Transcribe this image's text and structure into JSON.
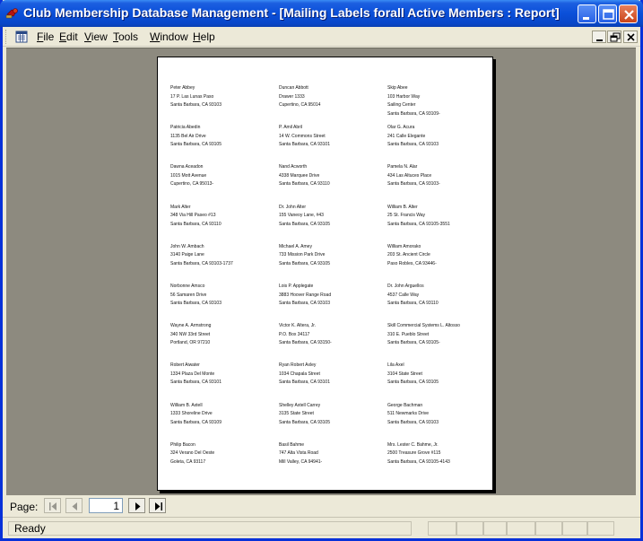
{
  "window": {
    "title": "Club Membership Database Management - [Mailing Labels forall  Active Members : Report]"
  },
  "menu": {
    "items": [
      {
        "key": "F",
        "rest": "ile"
      },
      {
        "key": "E",
        "rest": "dit"
      },
      {
        "key": "V",
        "rest": "iew"
      },
      {
        "key": "T",
        "rest": "ools"
      },
      {
        "key": "W",
        "rest": "indow"
      },
      {
        "key": "H",
        "rest": "elp"
      }
    ]
  },
  "report": {
    "labels": [
      [
        "Peter Abbey",
        "17 P. Las Lunas Paso",
        "Santa Barbara, CA 93103"
      ],
      [
        "Duncan Abbott",
        "Drawer 1333",
        "Cupertino, CA 95014"
      ],
      [
        "Skip Abee",
        "103 Harbor Way",
        "Sailing Center",
        "Santa Barbara, CA 93109-"
      ],
      [
        "Patricia Abedin",
        "1135 Bel Air Drive",
        "Santa Barbara, CA 93105"
      ],
      [
        "P. Amil Abril",
        "14 W. Commons Street",
        "Santa Barbara, CA 93101"
      ],
      [
        "Olar G. Acura",
        "241 Calle Elegante",
        "Santa Barbara, CA 93103"
      ],
      [
        "Dawna Aceadon",
        "1015 Mott Avenue",
        "Cupertino, CA 95013-"
      ],
      [
        "Nand Acworth",
        "4338 Marquee Drive",
        "Santa Barbara, CA 93110"
      ],
      [
        "Pamela N. Alar",
        "434 Las Altuces Place",
        "Santa Barbara, CA 93103-"
      ],
      [
        "Mark Alter",
        "348 Via Hill Paseo #13",
        "Santa Barbara, CA 93110"
      ],
      [
        "Dr. John Alter",
        "155 Vaneoy Lane, #43",
        "Santa Barbara, CA 93105"
      ],
      [
        "William B. Alter",
        "25 St. Francis Way",
        "Santa Barbara, CA 93105-3551"
      ],
      [
        "John W. Ambach",
        "3140 Paige Lane",
        "Santa Barbara, CA 93103-1737"
      ],
      [
        "Michael A. Amey",
        "733 Mission Park Drive",
        "Santa Barbara, CA 93105"
      ],
      [
        "William Amorako",
        "203 St. Ancient Circle",
        "Paso Robles, CA 93446-"
      ],
      [
        "Norbonne Amsco",
        "56 Samaren Drive",
        "Santa Barbara, CA 93103"
      ],
      [
        "Lois P. Applegate",
        "3883 Hoover Range Road",
        "Santa Barbara, CA 93103"
      ],
      [
        "Dr. John Arguellos",
        "4537 Calle Way",
        "Santa Barbara, CA 93110"
      ],
      [
        "Wayne A. Armstrong",
        "340 NW 33rd Street",
        "Portland, OR 97210"
      ],
      [
        "Victor K. Altera, Jr.",
        "P.O. Box 34117",
        "Santa Barbara, CA 93150-"
      ],
      [
        "Skill Commercial Systems L. Altosso",
        "310 E. Pueblo Street",
        "Santa Barbara, CA 93105-"
      ],
      [
        "Robert Aiwater",
        "1334 Plaza Del Monte",
        "Santa Barbara, CA 93101"
      ],
      [
        "Ryan Robert Axley",
        "1034 Chapala Street",
        "Santa Barbara, CA 93101"
      ],
      [
        "Lila Axel",
        "3104 State Street",
        "Santa Barbara, CA 93105"
      ],
      [
        "William B. Axtell",
        "1333 Shoreline Drive",
        "Santa Barbara, CA 93109"
      ],
      [
        "Shelley Axtell Carrey",
        "3135 State Street",
        "Santa Barbara, CA 93105"
      ],
      [
        "George Bachman",
        "511 Newmarks Drive",
        "Santa Barbara, CA 93103"
      ],
      [
        "Philip Bacon",
        "324 Verano Del Oeste",
        "Goleta, CA 93117"
      ],
      [
        "Basil Bahme",
        "747 Alta Vista Road",
        "Mill Valley, CA 94941-"
      ],
      [
        "Mrs. Lester C. Bahme, Jr.",
        "2500 Treasure Grove #115",
        "Santa Barbara, CA 93105-4143"
      ]
    ]
  },
  "navigation": {
    "page_label": "Page:",
    "current_page": "1"
  },
  "status": {
    "text": "Ready"
  }
}
